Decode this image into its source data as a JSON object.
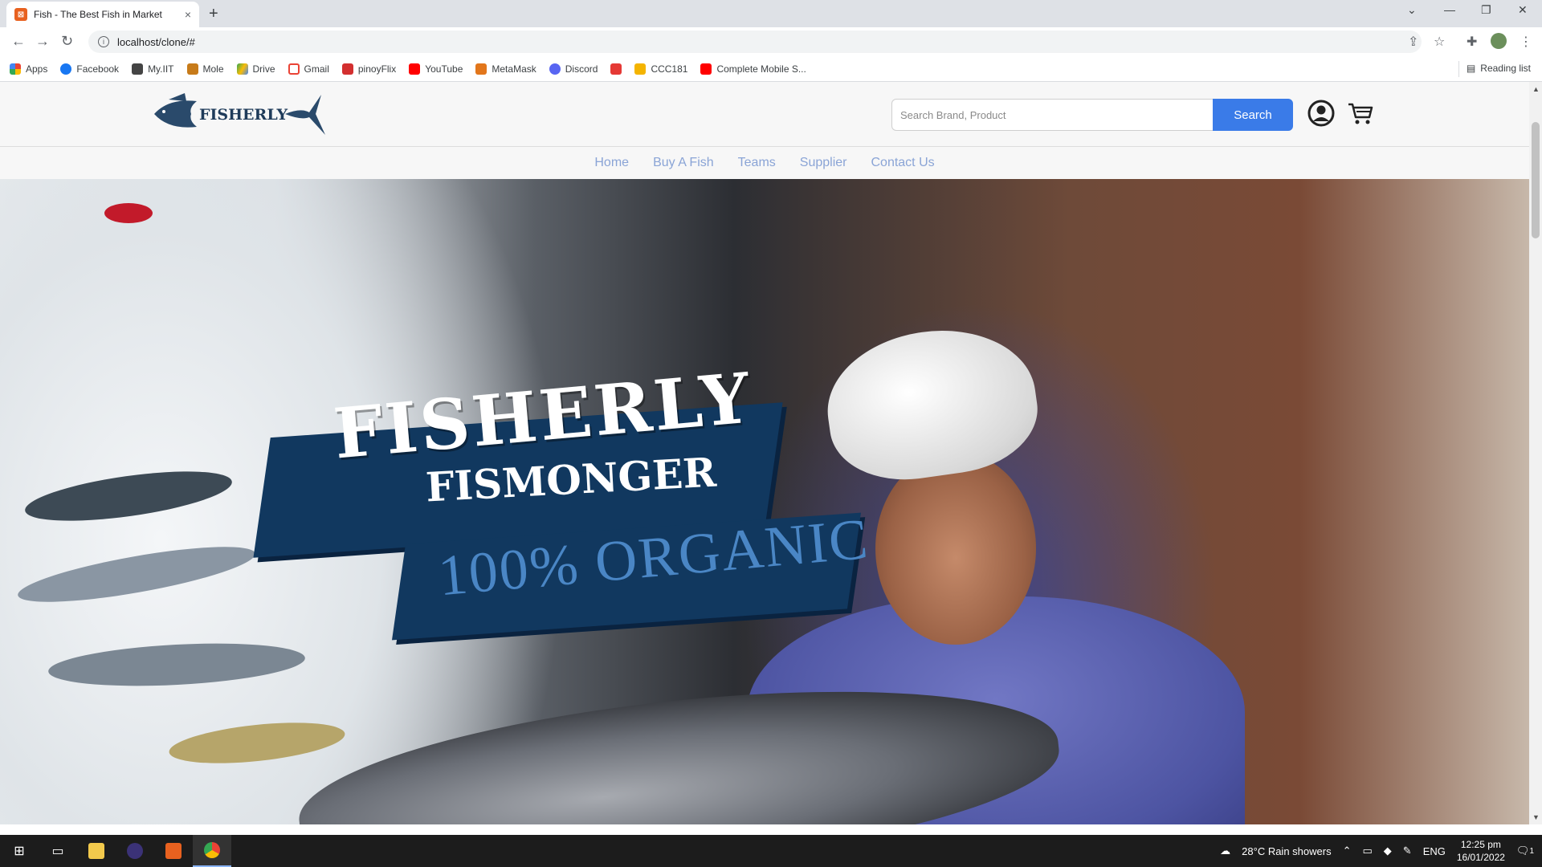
{
  "browser": {
    "tab_title": "Fish - The Best Fish in Market",
    "tab_close": "×",
    "new_tab": "+",
    "url": "localhost/clone/#",
    "bookmarks": [
      {
        "label": "Apps",
        "color": "#ea4335"
      },
      {
        "label": "Facebook",
        "color": "#1877f2"
      },
      {
        "label": "My.IIT",
        "color": "#444444"
      },
      {
        "label": "Mole",
        "color": "#c77b1a"
      },
      {
        "label": "Drive",
        "color": "#34a853"
      },
      {
        "label": "Gmail",
        "color": "#ea4335"
      },
      {
        "label": "pinoyFlix",
        "color": "#d32f2f"
      },
      {
        "label": "YouTube",
        "color": "#ff0000"
      },
      {
        "label": "MetaMask",
        "color": "#e2761b"
      },
      {
        "label": "Discord",
        "color": "#5865f2"
      },
      {
        "label": "",
        "color": "#e53935"
      },
      {
        "label": "CCC181",
        "color": "#f4b400"
      },
      {
        "label": "Complete Mobile S...",
        "color": "#ff0000"
      }
    ],
    "reading_list": "Reading list"
  },
  "site": {
    "logo_text": "FISHERLY",
    "search_placeholder": "Search Brand, Product",
    "search_button": "Search",
    "nav": [
      "Home",
      "Buy A Fish",
      "Teams",
      "Supplier",
      "Contact Us"
    ],
    "hero": {
      "title": "FISHERLY",
      "subtitle": "FISMONGER",
      "tagline": "100% ORGANIC"
    },
    "brand_color": "#11385f",
    "accent_color": "#3a7be8",
    "nav_color": "#8aa4d6"
  },
  "taskbar": {
    "weather": "28°C  Rain showers",
    "language": "ENG",
    "time": "12:25 pm",
    "date": "16/01/2022",
    "notification_count": "1"
  }
}
